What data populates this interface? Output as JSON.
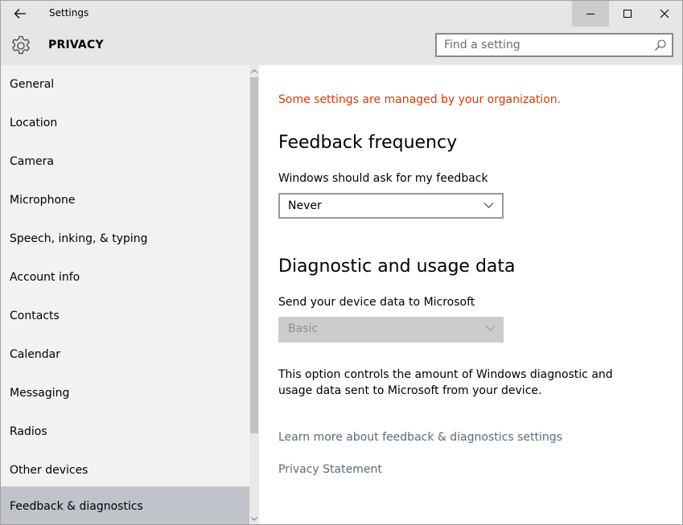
{
  "window": {
    "title": "Settings",
    "controls": {
      "minimize": "minimize",
      "maximize": "maximize",
      "close": "close"
    }
  },
  "header": {
    "section_title": "PRIVACY",
    "search": {
      "placeholder": "Find a setting",
      "value": ""
    }
  },
  "sidebar": {
    "items": [
      {
        "label": "General"
      },
      {
        "label": "Location"
      },
      {
        "label": "Camera"
      },
      {
        "label": "Microphone"
      },
      {
        "label": "Speech, inking, & typing"
      },
      {
        "label": "Account info"
      },
      {
        "label": "Contacts"
      },
      {
        "label": "Calendar"
      },
      {
        "label": "Messaging"
      },
      {
        "label": "Radios"
      },
      {
        "label": "Other devices"
      },
      {
        "label": "Feedback & diagnostics",
        "selected": true
      }
    ]
  },
  "main": {
    "managed_notice": "Some settings are managed by your organization.",
    "feedback": {
      "heading": "Feedback frequency",
      "label": "Windows should ask for my feedback",
      "value": "Never"
    },
    "diagnostics": {
      "heading": "Diagnostic and usage data",
      "label": "Send your device data to Microsoft",
      "value": "Basic",
      "disabled": true,
      "description": "This option controls the amount of Windows diagnostic and usage data sent to Microsoft from your device."
    },
    "links": {
      "learn_more": "Learn more about feedback & diagnostics settings",
      "privacy": "Privacy Statement"
    }
  },
  "colors": {
    "accent_warning": "#d83b01",
    "link": "#5b6b80",
    "selected_nav": "#c0c3ca",
    "chrome": "#e6e6e6",
    "sidebar": "#f2f2f2"
  },
  "icons": [
    "back-arrow-icon",
    "gear-icon",
    "search-icon",
    "minimize-icon",
    "maximize-icon",
    "close-icon",
    "chevron-down-icon"
  ]
}
